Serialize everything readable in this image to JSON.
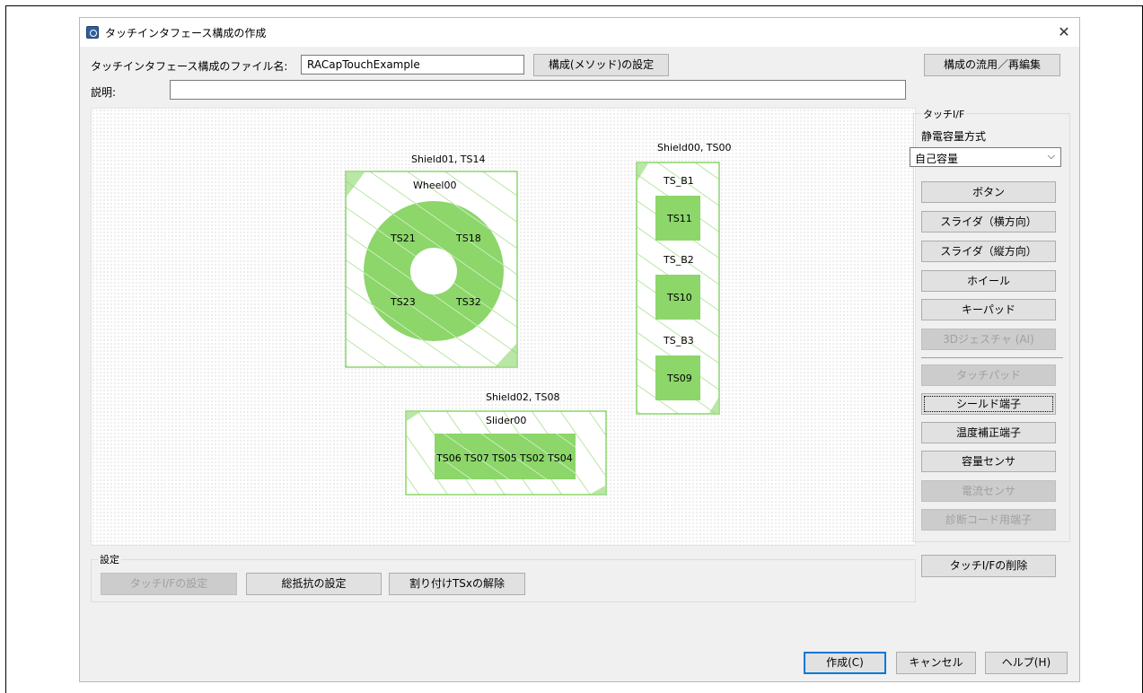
{
  "window": {
    "title": "タッチインタフェース構成の作成",
    "close_glyph": "✕"
  },
  "header": {
    "filename_label": "タッチインタフェース構成のファイル名:",
    "filename_value": "RACapTouchExample",
    "method_button": "構成(メソッド)の設定",
    "reuse_button": "構成の流用／再編集",
    "description_label": "説明:",
    "description_value": ""
  },
  "canvas": {
    "wheel_group": {
      "shield_label": "Shield01, TS14",
      "name": "Wheel00",
      "sensors": [
        "TS21",
        "TS18",
        "TS23",
        "TS32"
      ]
    },
    "button_group": {
      "shield_label": "Shield00, TS00",
      "buttons": [
        {
          "name": "TS_B1",
          "sensor": "TS11"
        },
        {
          "name": "TS_B2",
          "sensor": "TS10"
        },
        {
          "name": "TS_B3",
          "sensor": "TS09"
        }
      ]
    },
    "slider_group": {
      "shield_label": "Shield02, TS08",
      "name": "Slider00",
      "sensors": [
        "TS06",
        "TS07",
        "TS05",
        "TS02",
        "TS04"
      ]
    },
    "colors": {
      "fill": "#8cd66a",
      "border": "#8cd66a",
      "hatch": "#ffffff"
    }
  },
  "touch_if": {
    "group_label": "タッチI/F",
    "method_label": "静電容量方式",
    "method_value": "自己容量",
    "buttons": [
      {
        "label": "ボタン",
        "enabled": true
      },
      {
        "label": "スライダ（横方向）",
        "enabled": true
      },
      {
        "label": "スライダ（縦方向）",
        "enabled": true
      },
      {
        "label": "ホイール",
        "enabled": true
      },
      {
        "label": "キーパッド",
        "enabled": true
      },
      {
        "label": "3Dジェスチャ (AI)",
        "enabled": false
      },
      {
        "label": "タッチパッド",
        "enabled": false
      },
      {
        "label": "シールド端子",
        "enabled": true
      },
      {
        "label": "温度補正端子",
        "enabled": true
      },
      {
        "label": "容量センサ",
        "enabled": true
      },
      {
        "label": "電流センサ",
        "enabled": false
      },
      {
        "label": "診断コード用端子",
        "enabled": false
      }
    ],
    "delete_button": "タッチI/Fの削除"
  },
  "settings": {
    "group_label": "設定",
    "touch_if_settings": "タッチI/Fの設定",
    "resistance_settings": "総抵抗の設定",
    "release_ts": "割り付けTSxの解除"
  },
  "footer": {
    "create_button": "作成(C)",
    "cancel_button": "キャンセル",
    "help_button": "ヘルプ(H)"
  }
}
